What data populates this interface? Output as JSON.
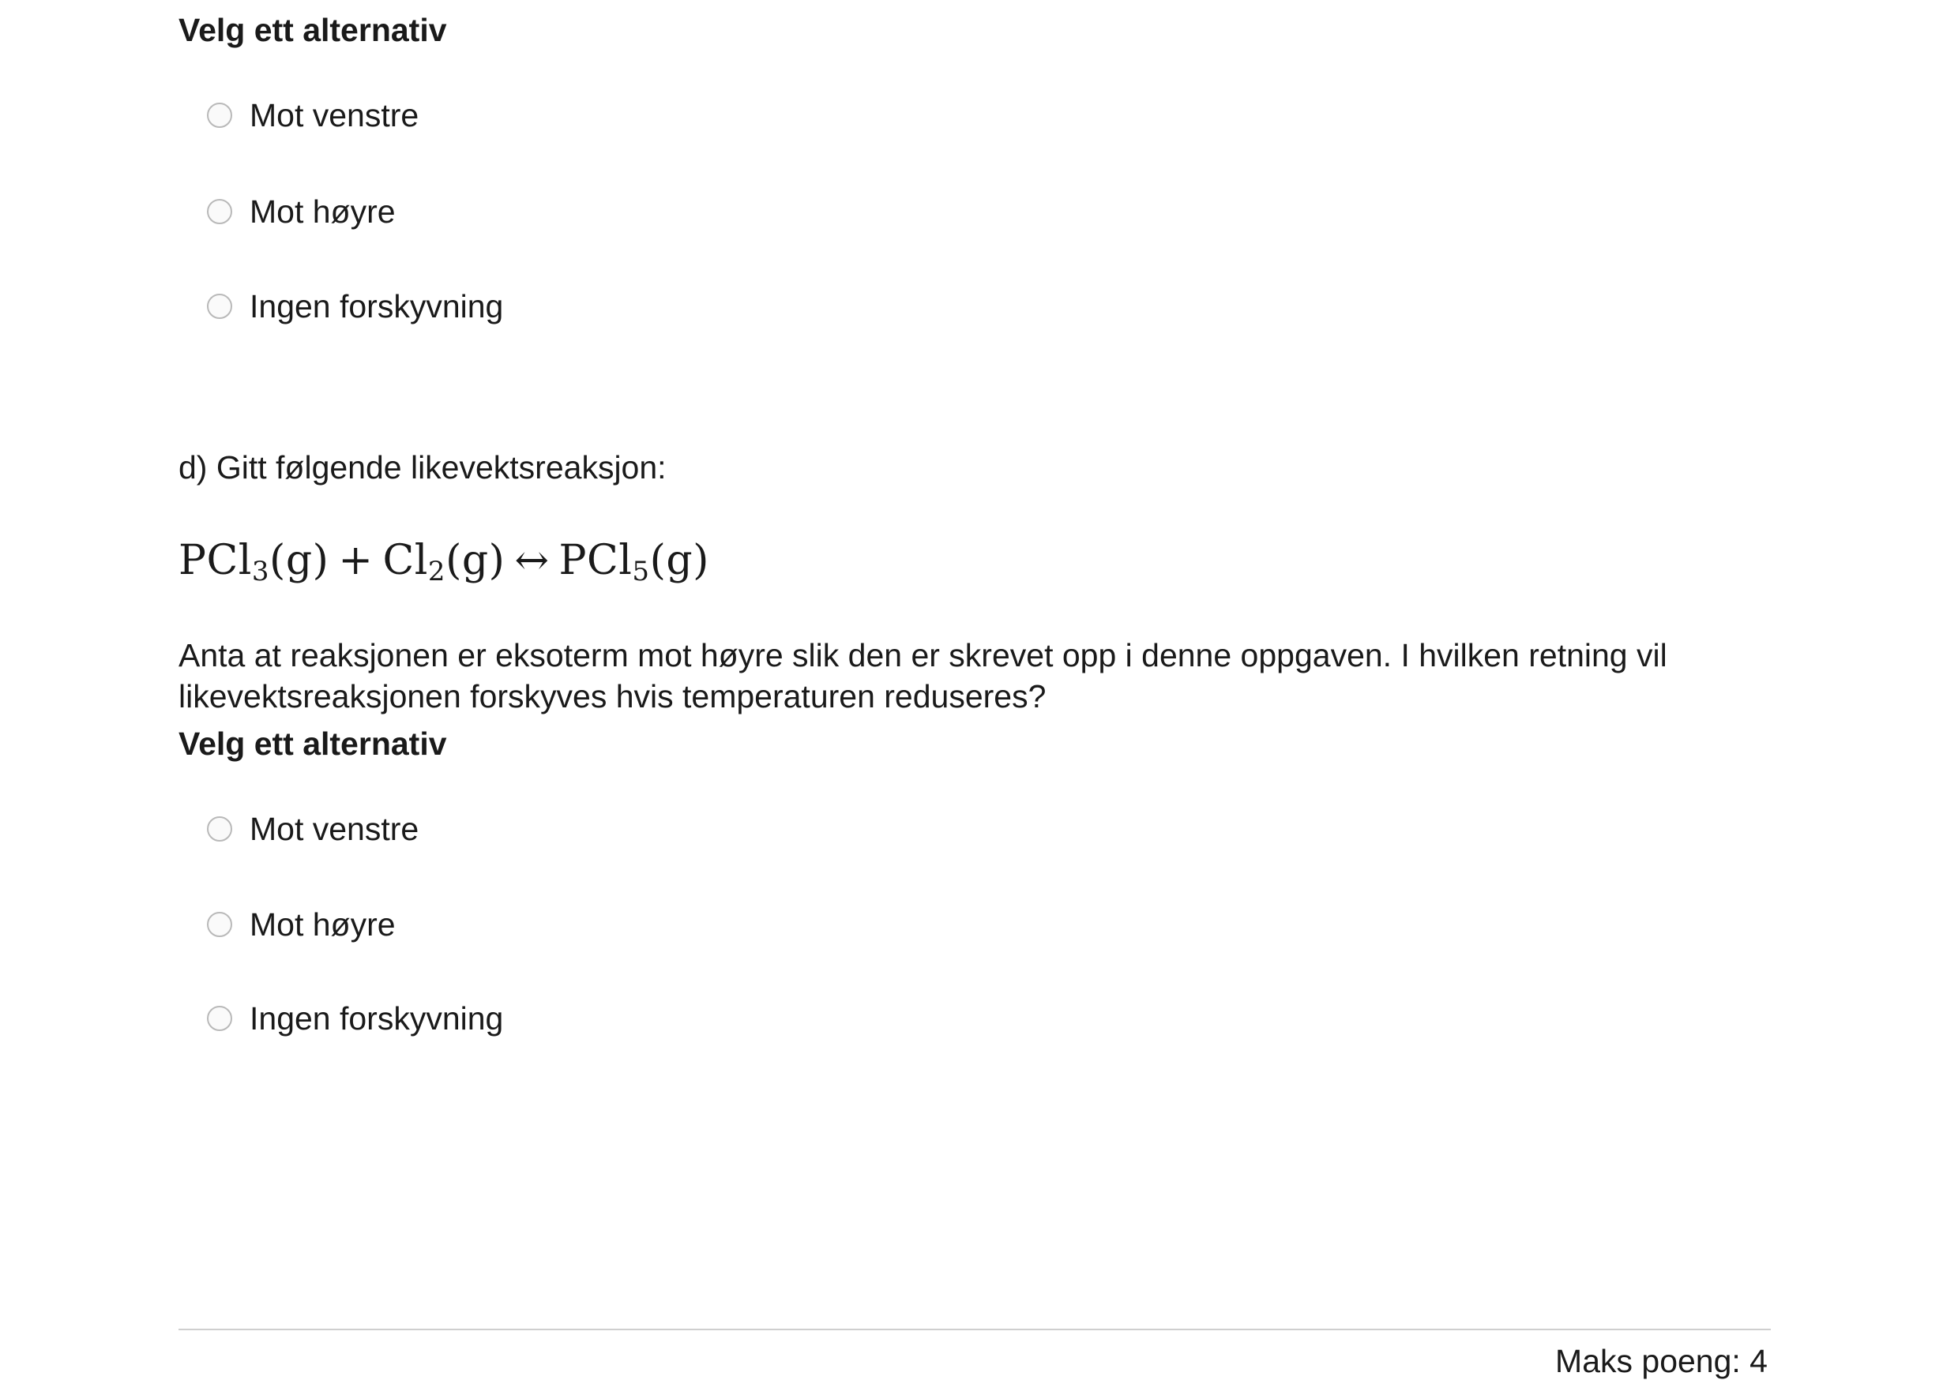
{
  "question_c": {
    "select_prompt": "Velg ett alternativ",
    "options": [
      "Mot venstre",
      "Mot høyre",
      "Ingen forskyvning"
    ]
  },
  "question_d": {
    "intro": "d) Gitt følgende likevektsreaksjon:",
    "equation": {
      "reactant1": "PCl",
      "reactant1_sub": "3",
      "reactant1_state": "(g)",
      "plus": "+",
      "reactant2": "Cl",
      "reactant2_sub": "2",
      "reactant2_state": "(g)",
      "arrow": "↔",
      "product": "PCl",
      "product_sub": "5",
      "product_state": "(g)"
    },
    "body": "Anta at reaksjonen er eksoterm mot høyre slik den er skrevet opp i denne oppgaven. I hvilken retning vil likevektsreaksjonen forskyves hvis temperaturen reduseres?",
    "select_prompt": "Velg ett alternativ",
    "options": [
      "Mot venstre",
      "Mot høyre",
      "Ingen forskyvning"
    ]
  },
  "footer": {
    "max_points": "Maks poeng: 4"
  }
}
